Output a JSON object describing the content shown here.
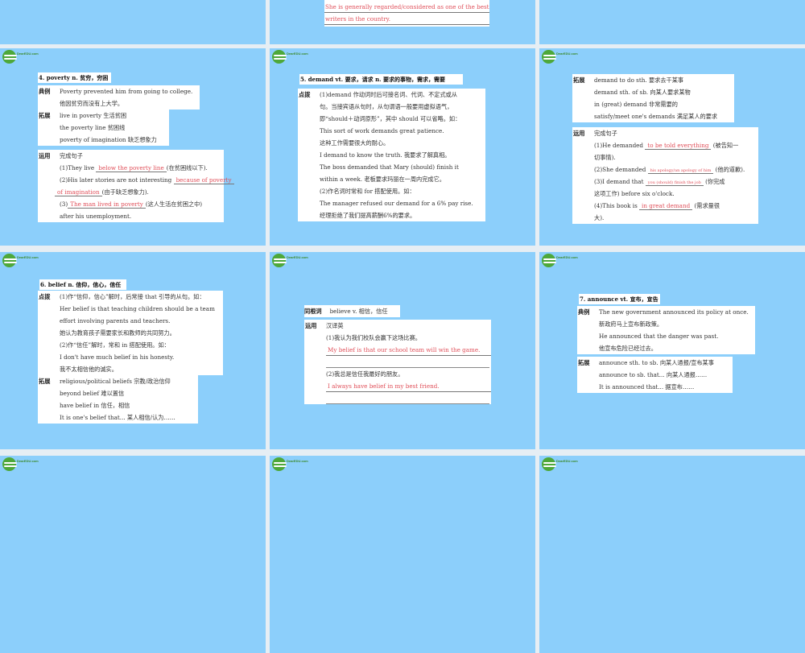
{
  "logo_text": "DearEDU.com",
  "top_slide": {
    "lines": [
      "She is generally regarded/considered as one of the best",
      "writers in the country."
    ]
  },
  "slides": [
    {
      "title": "4. poverty  n. 贫穷，穷困",
      "boxes": [
        {
          "label": "典例",
          "lines": [
            [
              {
                "t": "Poverty prevented him from going to college."
              }
            ],
            [
              {
                "t": "他因贫穷而没有上大学。"
              }
            ]
          ]
        },
        {
          "label": "拓展",
          "lines": [
            [
              {
                "t": "live in poverty 生活贫困"
              }
            ],
            [
              {
                "t": "the poverty line 贫困线"
              }
            ],
            [
              {
                "t": "poverty of imagination 缺乏想象力"
              }
            ]
          ]
        },
        {
          "label": "运用",
          "lines": [
            [
              {
                "t": "完成句子"
              }
            ],
            [
              {
                "t": "(1)They live "
              },
              {
                "t": "below the poverty line",
                "red": true,
                "u": true
              },
              {
                "t": "(在贫困线以下)."
              }
            ],
            [
              {
                "t": "(2)His later stories are not interesting "
              },
              {
                "t": "because of poverty",
                "red": true,
                "u": true
              }
            ],
            [
              {
                "t": "of imagination",
                "red": true,
                "u": true,
                "out": true
              },
              {
                "t": "(由于缺乏想象力)."
              }
            ],
            [
              {
                "t": "(3)"
              },
              {
                "t": "The man lived in poverty",
                "red": true,
                "u": true
              },
              {
                "t": "(这人生活在贫困之中)"
              }
            ],
            [
              {
                "t": "after his unemployment."
              }
            ]
          ]
        }
      ]
    },
    {
      "title": "5. demand  vt. 要求，请求   n. 要求的事物，需求，需要",
      "boxes": [
        {
          "label": "点拨",
          "lines": [
            [
              {
                "t": "(1)demand 作动词时后可接名词、代词、不定式或从"
              }
            ],
            [
              {
                "t": "句。当接宾语从句时，从句谓语一般要用虚拟语气，"
              }
            ],
            [
              {
                "t": "即“should＋动词原形”，其中 should 可以省略。如："
              }
            ],
            [
              {
                "t": "This sort of work demands great patience."
              }
            ],
            [
              {
                "t": "这种工作需要很大的耐心。"
              }
            ],
            [
              {
                "t": "I demand to know the truth. 我要求了解真相。"
              }
            ],
            [
              {
                "t": "The boss demanded that Mary (should) finish it"
              }
            ],
            [
              {
                "t": "within a week. 老板要求玛丽在一周内完成它。"
              }
            ],
            [
              {
                "t": "(2)作名词时常和 for 搭配使用。如："
              }
            ],
            [
              {
                "t": "The manager refused our demand for a 6% pay rise."
              }
            ],
            [
              {
                "t": "经理拒绝了我们提高薪酬6%的要求。"
              }
            ]
          ]
        }
      ]
    },
    {
      "title": "",
      "boxes": [
        {
          "label": "拓展",
          "lines": [
            [
              {
                "t": "demand to do sth. 要求去干某事"
              }
            ],
            [
              {
                "t": "demand sth. of sb. 向某人要求某物"
              }
            ],
            [
              {
                "t": "in (great) demand 非常需要的"
              }
            ],
            [
              {
                "t": "satisfy/meet one's demands 满足某人的要求"
              }
            ]
          ]
        },
        {
          "label": "运用",
          "lines": [
            [
              {
                "t": "完成句子"
              }
            ],
            [
              {
                "t": "(1)He demanded "
              },
              {
                "t": "to be told everything",
                "red": true,
                "u": true
              },
              {
                "t": " (被告知一"
              }
            ],
            [
              {
                "t": "切事情)."
              }
            ],
            [
              {
                "t": "(2)She demanded "
              },
              {
                "t": "his apology/an apology of him",
                "red": true,
                "u": true,
                "small": true
              },
              {
                "t": " (他的道歉)."
              }
            ],
            [
              {
                "t": "(3)I demand that "
              },
              {
                "t": "you (should) finish the job",
                "red": true,
                "u": true,
                "small": true
              },
              {
                "t": " (你完成"
              }
            ],
            [
              {
                "t": "这项工作) before six o'clock."
              }
            ],
            [
              {
                "t": "(4)This book is "
              },
              {
                "t": "in great demand",
                "red": true,
                "u": true
              },
              {
                "t": " (需求量很"
              }
            ],
            [
              {
                "t": "大)."
              }
            ]
          ]
        }
      ]
    },
    {
      "title": "6. belief  n. 信仰，信心，信任",
      "boxes": [
        {
          "label": "点拨",
          "lines": [
            [
              {
                "t": "(1)作“信仰，信心”解时，后常接 that 引导的从句。如："
              }
            ],
            [
              {
                "t": "Her belief is that teaching children should be a team"
              }
            ],
            [
              {
                "t": "effort involving parents and teachers."
              }
            ],
            [
              {
                "t": "她认为教育孩子需要家长和教师的共同努力。"
              }
            ],
            [
              {
                "t": "(2)作“信任”解时，常和 in 搭配使用。如："
              }
            ],
            [
              {
                "t": "I don't have much belief in his honesty."
              }
            ],
            [
              {
                "t": "我不太相信他的诚实。"
              }
            ]
          ]
        },
        {
          "label": "拓展",
          "lines": [
            [
              {
                "t": "religious/political beliefs 宗教/政治信仰"
              }
            ],
            [
              {
                "t": "beyond belief 难以置信"
              }
            ],
            [
              {
                "t": "have belief in 信任，相信"
              }
            ],
            [
              {
                "t": "It is one's belief that... 某人相信/认为……"
              }
            ]
          ]
        }
      ]
    },
    {
      "title": "",
      "boxes": [
        {
          "label": "同根词",
          "lines": [
            [
              {
                "t": "believe v. 相信，信任"
              }
            ]
          ]
        },
        {
          "label": "运用",
          "lines": [
            [
              {
                "t": "汉译英"
              }
            ],
            [
              {
                "t": "(1)我认为我们校队会赢下这场比赛。"
              }
            ],
            [
              {
                "t": "My belief is that our school team will win the game.",
                "red": true
              }
            ],
            [],
            [
              {
                "t": "(2)我总是信任我最好的朋友。"
              }
            ],
            [
              {
                "t": "I always have belief in my best friend.",
                "red": true
              }
            ],
            []
          ]
        }
      ]
    },
    {
      "title": "7. announce  vt. 宣布，宣告",
      "boxes": [
        {
          "label": "典例",
          "lines": [
            [
              {
                "t": "The new government announced its policy at once."
              }
            ],
            [
              {
                "t": "新政府马上宣布新政策。"
              }
            ],
            [
              {
                "t": "He announced that the danger was past."
              }
            ],
            [
              {
                "t": "他宣布危险已经过去。"
              }
            ]
          ]
        },
        {
          "label": "拓展",
          "lines": [
            [
              {
                "t": "announce sth. to sb. 向某人通报/宣布某事"
              }
            ],
            [
              {
                "t": "announce to sb. that... 向某人通报……"
              }
            ],
            [
              {
                "t": "It is announced that... 据宣布……"
              }
            ]
          ]
        }
      ]
    }
  ]
}
